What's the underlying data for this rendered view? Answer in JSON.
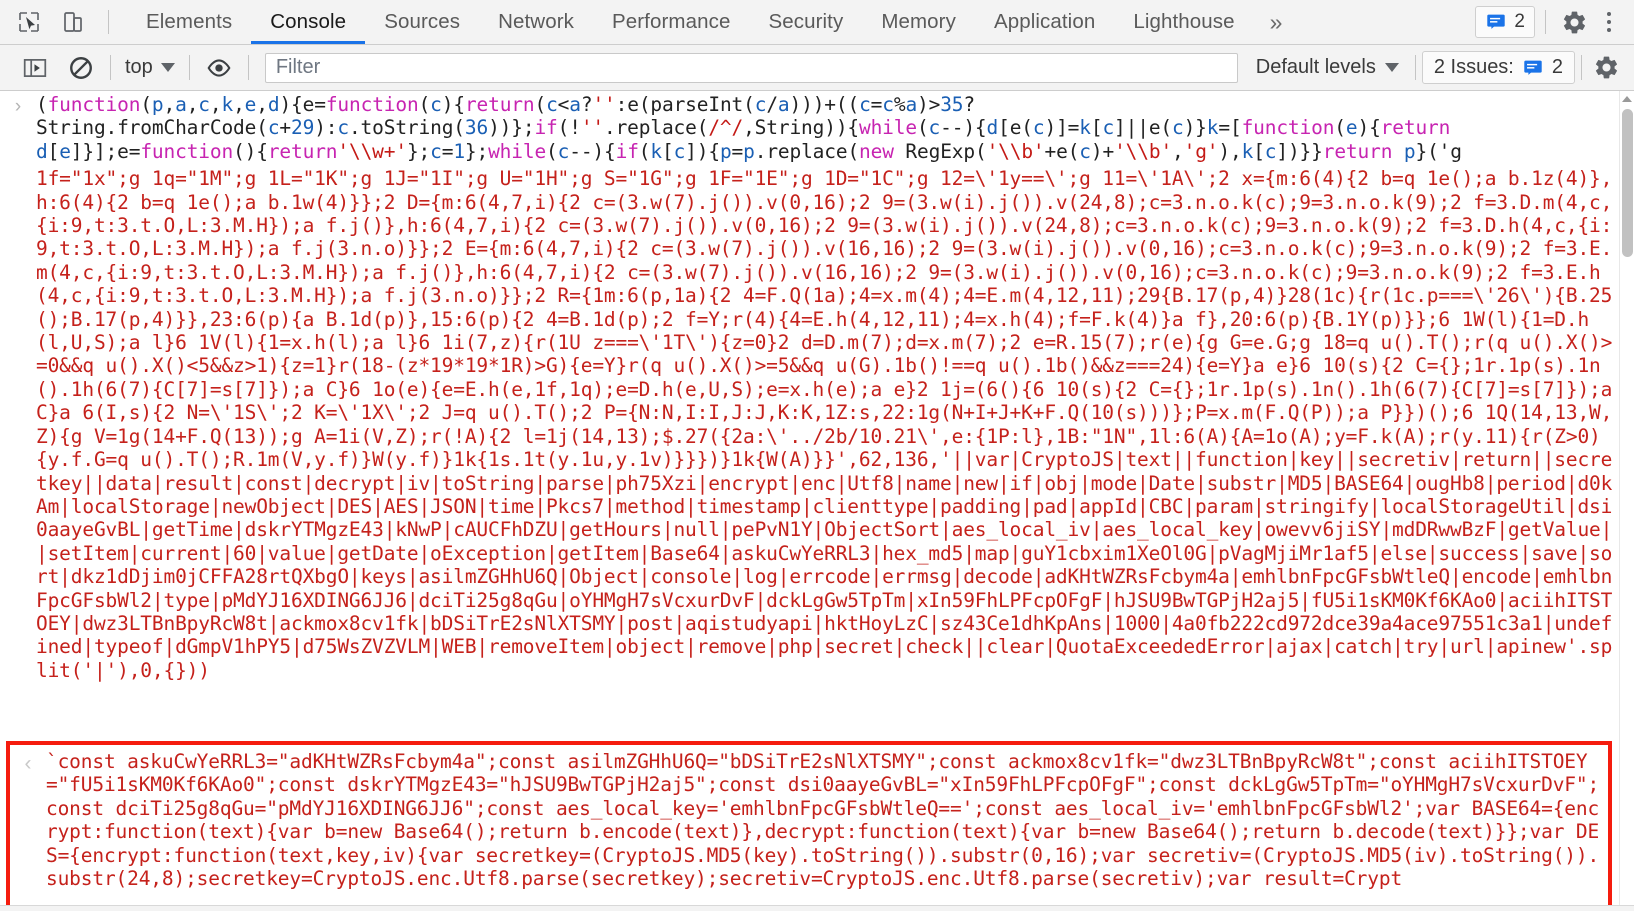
{
  "window": {
    "title": "Chrome DevTools Console"
  },
  "toolbar": {
    "inspect_icon": "inspect-cursor-icon",
    "device_icon": "device-toolbar-icon",
    "tabs": [
      {
        "label": "Elements",
        "active": false
      },
      {
        "label": "Console",
        "active": true
      },
      {
        "label": "Sources",
        "active": false
      },
      {
        "label": "Network",
        "active": false
      },
      {
        "label": "Performance",
        "active": false
      },
      {
        "label": "Security",
        "active": false
      },
      {
        "label": "Memory",
        "active": false
      },
      {
        "label": "Application",
        "active": false
      },
      {
        "label": "Lighthouse",
        "active": false
      }
    ],
    "more_tabs_label": "»",
    "issues_count": "2",
    "settings_icon": "gear-icon",
    "more_options_icon": "kebab-menu-icon"
  },
  "filterbar": {
    "sidebar_toggle_icon": "console-sidebar-icon",
    "clear_icon": "clear-console-icon",
    "context_value": "top",
    "eye_icon": "live-expression-icon",
    "filter_value": "",
    "filter_placeholder": "Filter",
    "levels_label": "Default levels",
    "issues_label": "2 Issues:",
    "issues_count": "2",
    "settings_icon": "gear-icon"
  },
  "console": {
    "input_prompt_icon": "expand-arrow-right",
    "result_prompt_icon": "result-arrow-left",
    "input_message": {
      "type": "input",
      "segments": [
        {
          "t": "(",
          "c": "plain"
        },
        {
          "t": "function",
          "c": "kw"
        },
        {
          "t": "(",
          "c": "plain"
        },
        {
          "t": "p",
          "c": "var"
        },
        {
          "t": ",",
          "c": "plain"
        },
        {
          "t": "a",
          "c": "var"
        },
        {
          "t": ",",
          "c": "plain"
        },
        {
          "t": "c",
          "c": "var"
        },
        {
          "t": ",",
          "c": "plain"
        },
        {
          "t": "k",
          "c": "var"
        },
        {
          "t": ",",
          "c": "plain"
        },
        {
          "t": "e",
          "c": "var"
        },
        {
          "t": ",",
          "c": "plain"
        },
        {
          "t": "d",
          "c": "var"
        },
        {
          "t": "){e=",
          "c": "plain"
        },
        {
          "t": "function",
          "c": "kw"
        },
        {
          "t": "(",
          "c": "plain"
        },
        {
          "t": "c",
          "c": "var"
        },
        {
          "t": "){",
          "c": "plain"
        },
        {
          "t": "return",
          "c": "kw"
        },
        {
          "t": "(",
          "c": "plain"
        },
        {
          "t": "c",
          "c": "var"
        },
        {
          "t": "<",
          "c": "plain"
        },
        {
          "t": "a",
          "c": "var"
        },
        {
          "t": "?",
          "c": "plain"
        },
        {
          "t": "''",
          "c": "str"
        },
        {
          "t": ":e(parseInt(",
          "c": "plain"
        },
        {
          "t": "c",
          "c": "var"
        },
        {
          "t": "/",
          "c": "plain"
        },
        {
          "t": "a",
          "c": "var"
        },
        {
          "t": ")))+((",
          "c": "plain"
        },
        {
          "t": "c",
          "c": "var"
        },
        {
          "t": "=",
          "c": "plain"
        },
        {
          "t": "c",
          "c": "var"
        },
        {
          "t": "%",
          "c": "plain"
        },
        {
          "t": "a",
          "c": "var"
        },
        {
          "t": ")>",
          "c": "plain"
        },
        {
          "t": "35",
          "c": "num"
        },
        {
          "t": "?\nString.fromCharCode(",
          "c": "plain"
        },
        {
          "t": "c",
          "c": "var"
        },
        {
          "t": "+",
          "c": "plain"
        },
        {
          "t": "29",
          "c": "num"
        },
        {
          "t": "):",
          "c": "plain"
        },
        {
          "t": "c",
          "c": "var"
        },
        {
          "t": ".toString(",
          "c": "plain"
        },
        {
          "t": "36",
          "c": "num"
        },
        {
          "t": "))};",
          "c": "plain"
        },
        {
          "t": "if",
          "c": "kw"
        },
        {
          "t": "(!",
          "c": "plain"
        },
        {
          "t": "''",
          "c": "str"
        },
        {
          "t": ".replace(",
          "c": "plain"
        },
        {
          "t": "/^/",
          "c": "str"
        },
        {
          "t": ",String)){",
          "c": "plain"
        },
        {
          "t": "while",
          "c": "kw"
        },
        {
          "t": "(",
          "c": "plain"
        },
        {
          "t": "c",
          "c": "var"
        },
        {
          "t": "--){",
          "c": "plain"
        },
        {
          "t": "d",
          "c": "var"
        },
        {
          "t": "[e(",
          "c": "plain"
        },
        {
          "t": "c",
          "c": "var"
        },
        {
          "t": ")]=",
          "c": "plain"
        },
        {
          "t": "k",
          "c": "var"
        },
        {
          "t": "[",
          "c": "plain"
        },
        {
          "t": "c",
          "c": "var"
        },
        {
          "t": "]||e(",
          "c": "plain"
        },
        {
          "t": "c",
          "c": "var"
        },
        {
          "t": ")}",
          "c": "plain"
        },
        {
          "t": "k",
          "c": "var"
        },
        {
          "t": "=[",
          "c": "plain"
        },
        {
          "t": "function",
          "c": "kw"
        },
        {
          "t": "(",
          "c": "plain"
        },
        {
          "t": "e",
          "c": "var"
        },
        {
          "t": "){",
          "c": "plain"
        },
        {
          "t": "return",
          "c": "kw"
        },
        {
          "t": "\n",
          "c": "plain"
        },
        {
          "t": "d",
          "c": "var"
        },
        {
          "t": "[",
          "c": "plain"
        },
        {
          "t": "e",
          "c": "var"
        },
        {
          "t": "]}];e=",
          "c": "plain"
        },
        {
          "t": "function",
          "c": "kw"
        },
        {
          "t": "(){",
          "c": "plain"
        },
        {
          "t": "return",
          "c": "kw"
        },
        {
          "t": "'\\\\w+'",
          "c": "str"
        },
        {
          "t": "};",
          "c": "plain"
        },
        {
          "t": "c",
          "c": "var"
        },
        {
          "t": "=",
          "c": "plain"
        },
        {
          "t": "1",
          "c": "num"
        },
        {
          "t": "};",
          "c": "plain"
        },
        {
          "t": "while",
          "c": "kw"
        },
        {
          "t": "(",
          "c": "plain"
        },
        {
          "t": "c",
          "c": "var"
        },
        {
          "t": "--){",
          "c": "plain"
        },
        {
          "t": "if",
          "c": "kw"
        },
        {
          "t": "(",
          "c": "plain"
        },
        {
          "t": "k",
          "c": "var"
        },
        {
          "t": "[",
          "c": "plain"
        },
        {
          "t": "c",
          "c": "var"
        },
        {
          "t": "]){",
          "c": "plain"
        },
        {
          "t": "p",
          "c": "var"
        },
        {
          "t": "=",
          "c": "plain"
        },
        {
          "t": "p",
          "c": "var"
        },
        {
          "t": ".replace(",
          "c": "plain"
        },
        {
          "t": "new",
          "c": "kw"
        },
        {
          "t": " RegExp(",
          "c": "plain"
        },
        {
          "t": "'\\\\b'",
          "c": "str"
        },
        {
          "t": "+e(",
          "c": "plain"
        },
        {
          "t": "c",
          "c": "var"
        },
        {
          "t": ")+",
          "c": "plain"
        },
        {
          "t": "'\\\\b'",
          "c": "str"
        },
        {
          "t": ",",
          "c": "plain"
        },
        {
          "t": "'g'",
          "c": "str"
        },
        {
          "t": "),",
          "c": "plain"
        },
        {
          "t": "k",
          "c": "var"
        },
        {
          "t": "[",
          "c": "plain"
        },
        {
          "t": "c",
          "c": "var"
        },
        {
          "t": "])}}",
          "c": "plain"
        },
        {
          "t": "return",
          "c": "kw"
        },
        {
          "t": " ",
          "c": "plain"
        },
        {
          "t": "p",
          "c": "var"
        },
        {
          "t": "}('g",
          "c": "plain"
        }
      ]
    },
    "error_message": {
      "type": "error",
      "text": "1f=\"1x\";g 1q=\"1M\";g 1L=\"1K\";g 1J=\"1I\";g U=\"1H\";g S=\"1G\";g 1F=\"1E\";g 1D=\"1C\";g 12=\\'1y==\\';g 11=\\'1A\\';2 x={m:6(4){2 b=q 1e();a b.1z(4)},h:6(4){2 b=q 1e();a b.1w(4)}};2 D={m:6(4,7,i){2 c=(3.w(7).j()).v(0,16);2 9=(3.w(i).j()).v(24,8);c=3.n.o.k(c);9=3.n.o.k(9);2 f=3.D.m(4,c,{i:9,t:3.t.O,L:3.M.H});a f.j()},h:6(4,7,i){2 c=(3.w(7).j()).v(0,16);2 9=(3.w(i).j()).v(24,8);c=3.n.o.k(c);9=3.n.o.k(9);2 f=3.D.h(4,c,{i:9,t:3.t.O,L:3.M.H});a f.j(3.n.o)}};2 E={m:6(4,7,i){2 c=(3.w(7).j()).v(16,16);2 9=(3.w(i).j()).v(0,16);c=3.n.o.k(c);9=3.n.o.k(9);2 f=3.E.m(4,c,{i:9,t:3.t.O,L:3.M.H});a f.j()},h:6(4,7,i){2 c=(3.w(7).j()).v(16,16);2 9=(3.w(i).j()).v(0,16);c=3.n.o.k(c);9=3.n.o.k(9);2 f=3.E.h(4,c,{i:9,t:3.t.O,L:3.M.H});a f.j(3.n.o)}};2 R={1m:6(p,1a){2 4=F.Q(1a);4=x.m(4);4=E.m(4,12,11);29{B.17(p,4)}28(1c){r(1c.p===\\'26\\'){B.25();B.17(p,4)}},23:6(p){a B.1d(p)},15:6(p){2 4=B.1d(p);2 f=Y;r(4){4=E.h(4,12,11);4=x.h(4);f=F.k(4)}a f},20:6(p){B.1Y(p)}};6 1W(l){1=D.h(l,U,S);a l}6 1V(l){1=x.h(l);a l}6 1i(7,z){r(1U z===\\'1T\\'){z=0}2 d=D.m(7);d=x.m(7);2 e=R.15(7);r(e){g G=e.G;g 18=q u().T();r(q u().X()>=0&&q u().X()<5&&z>1){z=1}r(18-(z*19*19*1R)>G){e=Y}r(q u().X()>=5&&q u(G).1b()!==q u().1b()&&z===24){e=Y}a e}6 10(s){2 C={};1r.1p(s).1n().1h(6(7){C[7]=s[7]});a C}6 1o(e){e=E.h(e,1f,1q);e=D.h(e,U,S);e=x.h(e);a e}2 1j=(6(){6 10(s){2 C={};1r.1p(s).1n().1h(6(7){C[7]=s[7]});a C}a 6(I,s){2 N=\\'1S\\';2 K=\\'1X\\';2 J=q u().T();2 P={N:N,I:I,J:J,K:K,1Z:s,22:1g(N+I+J+K+F.Q(10(s)))};P=x.m(F.Q(P));a P}})();6 1Q(14,13,W,Z){g V=1g(14+F.Q(13));g A=1i(V,Z);r(!A){2 l=1j(14,13);$.27({2a:\\'../2b/10.21\\',e:{1P:l},1B:\"1N\",1l:6(A){A=1o(A);y=F.k(A);r(y.11){r(Z>0){y.f.G=q u().T();R.1m(V,y.f)}W(y.f)}1k{1s.1t(y.1u,y.1v)}}})}1k{W(A)}}',62,136,'||var|CryptoJS|text||function|key||secretiv|return||secretkey||data|result|const|decrypt|iv|toString|parse|ph75Xzi|encrypt|enc|Utf8|name|new|if|obj|mode|Date|substr|MD5|BASE64|ougHb8|period|d0kAm|localStorage|newObject|DES|AES|JSON|time|Pkcs7|method|timestamp|clienttype|padding|pad|appId|CBC|param|stringify|localStorageUtil|dsi0aayeGvBL|getTime|dskrYTMgzE43|kNwP|cAUCFhDZU|getHours|null|pePvN1Y|ObjectSort|aes_local_iv|aes_local_key|owevv6jiSY|mdDRwwBzF|getValue||setItem|current|60|value|getDate|oException|getItem|Base64|askuCwYeRRL3|hex_md5|map|guY1cbxim1XeOl0G|pVagMjiMr1af5|else|success|save|sort|dkz1dDjim0jCFFA28rtQXbgO|keys|asilmZGHhU6Q|Object|console|log|errcode|errmsg|decode|adKHtWZRsFcbym4a|emhlbnFpcGFsbWtleQ|encode|emhlbnFpcGFsbWl2|type|pMdYJ16XDING6JJ6|dciTi25g8qGu|oYHMgH7sVcxurDvF|dckLgGw5TpTm|xIn59FhLPFcpOFgF|hJSU9BwTGPjH2aj5|fU5i1sKM0Kf6KAo0|aciihITSTOEY|dwz3LTBnBpyRcW8t|ackmox8cv1fk|bDSiTrE2sNlXTSMY|post|aqistudyapi|hktHoyLzC|sz43Ce1dhKpAns|1000|4a0fb222cd972dce39a4ace97551c3a1|undefined|typeof|dGmpV1hPY5|d75WsZVZVLM|WEB|removeItem|object|remove|php|secret|check||clear|QuotaExceededError|ajax|catch|try|url|apinew'.split('|'),0,{}))",
      "tail_num": "62"
    },
    "result_message": {
      "type": "result",
      "text": "`const askuCwYeRRL3=\"adKHtWZRsFcbym4a\";const asilmZGHhU6Q=\"bDSiTrE2sNlXTSMY\";const ackmox8cv1fk=\"dwz3LTBnBpyRcW8t\";const aciihITSTOEY=\"fU5i1sKM0Kf6KAo0\";const dskrYTMgzE43=\"hJSU9BwTGPjH2aj5\";const dsi0aayeGvBL=\"xIn59FhLPFcpOFgF\";const dckLgGw5TpTm=\"oYHMgH7sVcxurDvF\";const dciTi25g8qGu=\"pMdYJ16XDING6JJ6\";const aes_local_key='emhlbnFpcGFsbWtleQ==';const aes_local_iv='emhlbnFpcGFsbWl2';var BASE64={encrypt:function(text){var b=new Base64();return b.encode(text)},decrypt:function(text){var b=new Base64();return b.decode(text)}};var DES={encrypt:function(text,key,iv){var secretkey=(CryptoJS.MD5(key).toString()).substr(0,16);var secretiv=(CryptoJS.MD5(iv).toString()).substr(24,8);secretkey=CryptoJS.enc.Utf8.parse(secretkey);secretiv=CryptoJS.enc.Utf8.parse(secretiv);var result=Crypt"
    }
  },
  "scrollbar": {
    "up_arrow_icon": "scroll-up-arrow"
  }
}
